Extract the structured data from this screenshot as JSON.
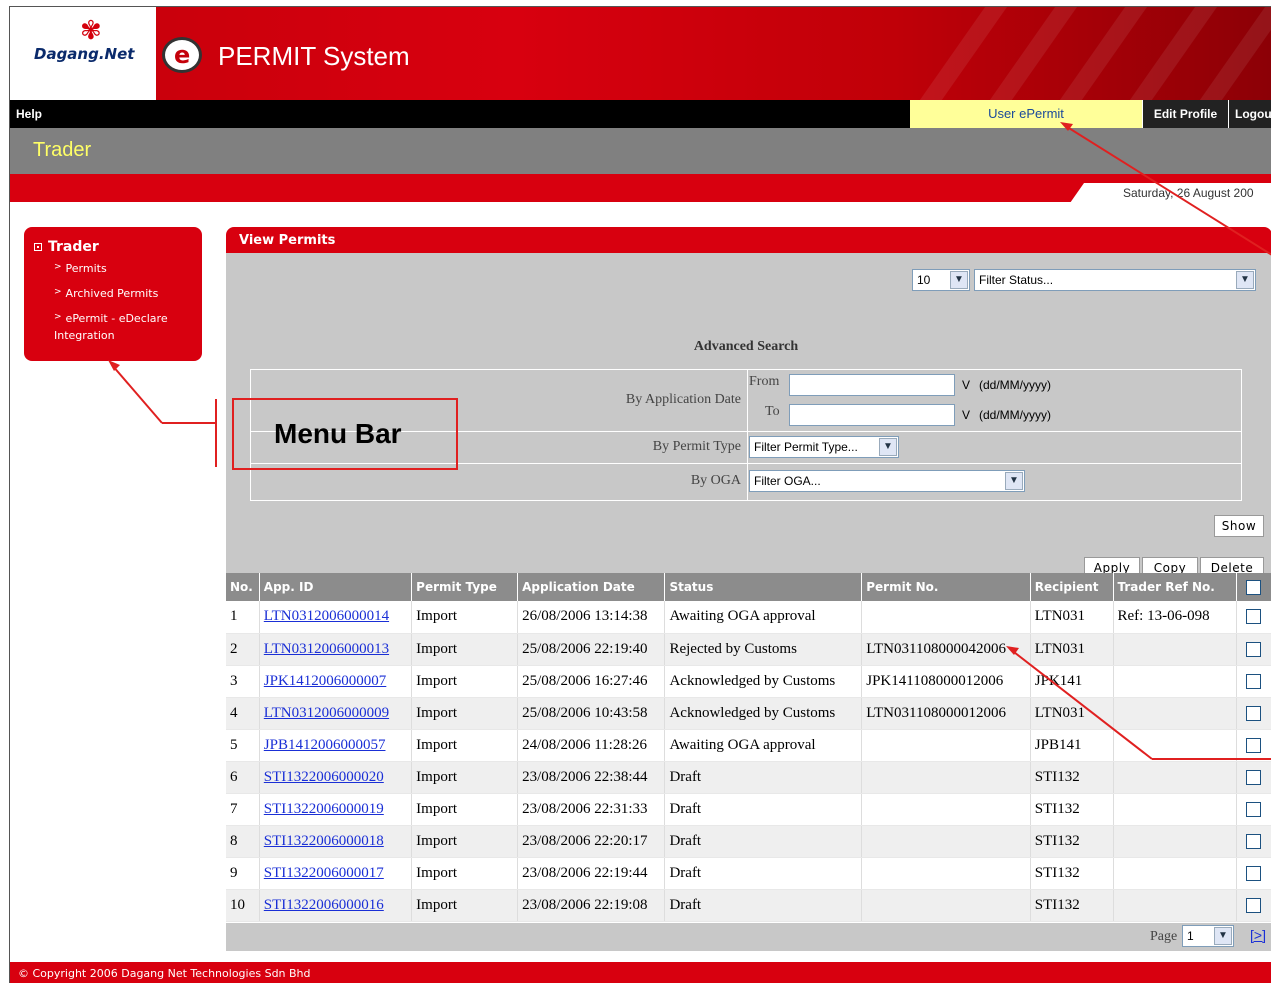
{
  "header": {
    "brand": "Dagang.Net",
    "e_logo": "e",
    "app_title": "PERMIT System"
  },
  "topnav": {
    "help": "Help",
    "user_epermit": "User ePermit",
    "edit_profile": "Edit Profile",
    "logout": "Logou"
  },
  "role": "Trader",
  "date": "Saturday, 26 August 200",
  "sidebar": {
    "title": "Trader",
    "items": [
      "Permits",
      "Archived Permits",
      "ePermit - eDeclare Integration"
    ]
  },
  "annotation": {
    "label": "Menu Bar"
  },
  "panel": {
    "title": "View Permits",
    "page_size": "10",
    "filter_status": "Filter Status...",
    "advanced_search": "Advanced Search",
    "by_application_date": "By Application Date",
    "from": "From",
    "to": "To",
    "v_from": "V",
    "v_to": "V",
    "date_format_from": "(dd/MM/yyyy)",
    "date_format_to": "(dd/MM/yyyy)",
    "by_permit_type": "By Permit Type",
    "filter_permit_type": "Filter Permit Type...",
    "by_oga": "By OGA",
    "filter_oga": "Filter OGA...",
    "show": "Show",
    "apply": "Apply",
    "copy": "Copy",
    "delete": "Delete"
  },
  "table": {
    "headers": [
      "No.",
      "App. ID",
      "Permit Type",
      "Application Date",
      "Status",
      "Permit No.",
      "Recipient",
      "Trader Ref No."
    ],
    "rows": [
      {
        "no": "1",
        "app_id": "LTN0312006000014",
        "type": "Import",
        "date": "26/08/2006 13:14:38",
        "status": "Awaiting OGA approval",
        "permit_no": "",
        "recipient": "LTN031",
        "ref": "Ref: 13-06-098"
      },
      {
        "no": "2",
        "app_id": "LTN0312006000013",
        "type": "Import",
        "date": "25/08/2006 22:19:40",
        "status": "Rejected by Customs",
        "permit_no": "LTN031108000042006",
        "recipient": "LTN031",
        "ref": ""
      },
      {
        "no": "3",
        "app_id": "JPK1412006000007",
        "type": "Import",
        "date": "25/08/2006 16:27:46",
        "status": "Acknowledged by Customs",
        "permit_no": "JPK141108000012006",
        "recipient": "JPK141",
        "ref": ""
      },
      {
        "no": "4",
        "app_id": "LTN0312006000009",
        "type": "Import",
        "date": "25/08/2006 10:43:58",
        "status": "Acknowledged by Customs",
        "permit_no": "LTN031108000012006",
        "recipient": "LTN031",
        "ref": ""
      },
      {
        "no": "5",
        "app_id": "JPB1412006000057",
        "type": "Import",
        "date": "24/08/2006 11:28:26",
        "status": "Awaiting OGA approval",
        "permit_no": "",
        "recipient": "JPB141",
        "ref": ""
      },
      {
        "no": "6",
        "app_id": "STI1322006000020",
        "type": "Import",
        "date": "23/08/2006 22:38:44",
        "status": "Draft",
        "permit_no": "",
        "recipient": "STI132",
        "ref": ""
      },
      {
        "no": "7",
        "app_id": "STI1322006000019",
        "type": "Import",
        "date": "23/08/2006 22:31:33",
        "status": "Draft",
        "permit_no": "",
        "recipient": "STI132",
        "ref": ""
      },
      {
        "no": "8",
        "app_id": "STI1322006000018",
        "type": "Import",
        "date": "23/08/2006 22:20:17",
        "status": "Draft",
        "permit_no": "",
        "recipient": "STI132",
        "ref": ""
      },
      {
        "no": "9",
        "app_id": "STI1322006000017",
        "type": "Import",
        "date": "23/08/2006 22:19:44",
        "status": "Draft",
        "permit_no": "",
        "recipient": "STI132",
        "ref": ""
      },
      {
        "no": "10",
        "app_id": "STI1322006000016",
        "type": "Import",
        "date": "23/08/2006 22:19:08",
        "status": "Draft",
        "permit_no": "",
        "recipient": "STI132",
        "ref": ""
      }
    ]
  },
  "pager": {
    "label": "Page",
    "current": "1",
    "next": "[>]"
  },
  "footer": "© Copyright 2006 Dagang Net Technologies Sdn Bhd",
  "colors": {
    "brand_red": "#d8000f",
    "nav_black": "#000000",
    "role_gray": "#808080",
    "panel_gray": "#c8c8c8",
    "link_blue": "#1a2fd6",
    "highlight_yellow": "#ffff99",
    "annotation_red": "#e02020"
  },
  "icons": [
    "dagang-net-flower-icon",
    "e-logo-icon",
    "checkbox-icon",
    "dropdown-arrow-icon",
    "sidebar-bullet-icon",
    "menu-arrow-icon"
  ]
}
